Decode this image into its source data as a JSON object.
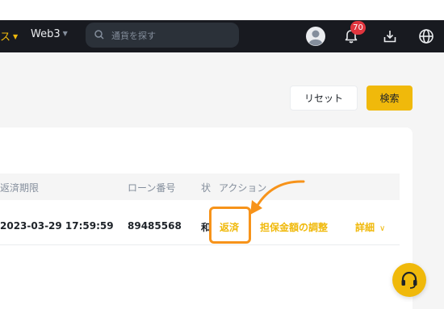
{
  "nav": {
    "services_label": "ス",
    "web3_label": "Web3",
    "search_placeholder": "通貨を探す",
    "notification_count": "70"
  },
  "filters": {
    "reset_label": "リセット",
    "search_label": "検索"
  },
  "table": {
    "headers": {
      "due": "返済期限",
      "loan_no": "ローン番号",
      "status": "状",
      "action": "アクション"
    },
    "rows": [
      {
        "due": "2023-03-29 17:59:59",
        "loan_no": "89485568",
        "status": "和",
        "actions": {
          "repay": "返済",
          "adjust": "担保金額の調整",
          "detail": "詳細"
        }
      }
    ]
  },
  "colors": {
    "accent": "#f0b90b",
    "highlight": "#f7931a",
    "navbar": "#181a20",
    "badge": "#e0353e"
  }
}
